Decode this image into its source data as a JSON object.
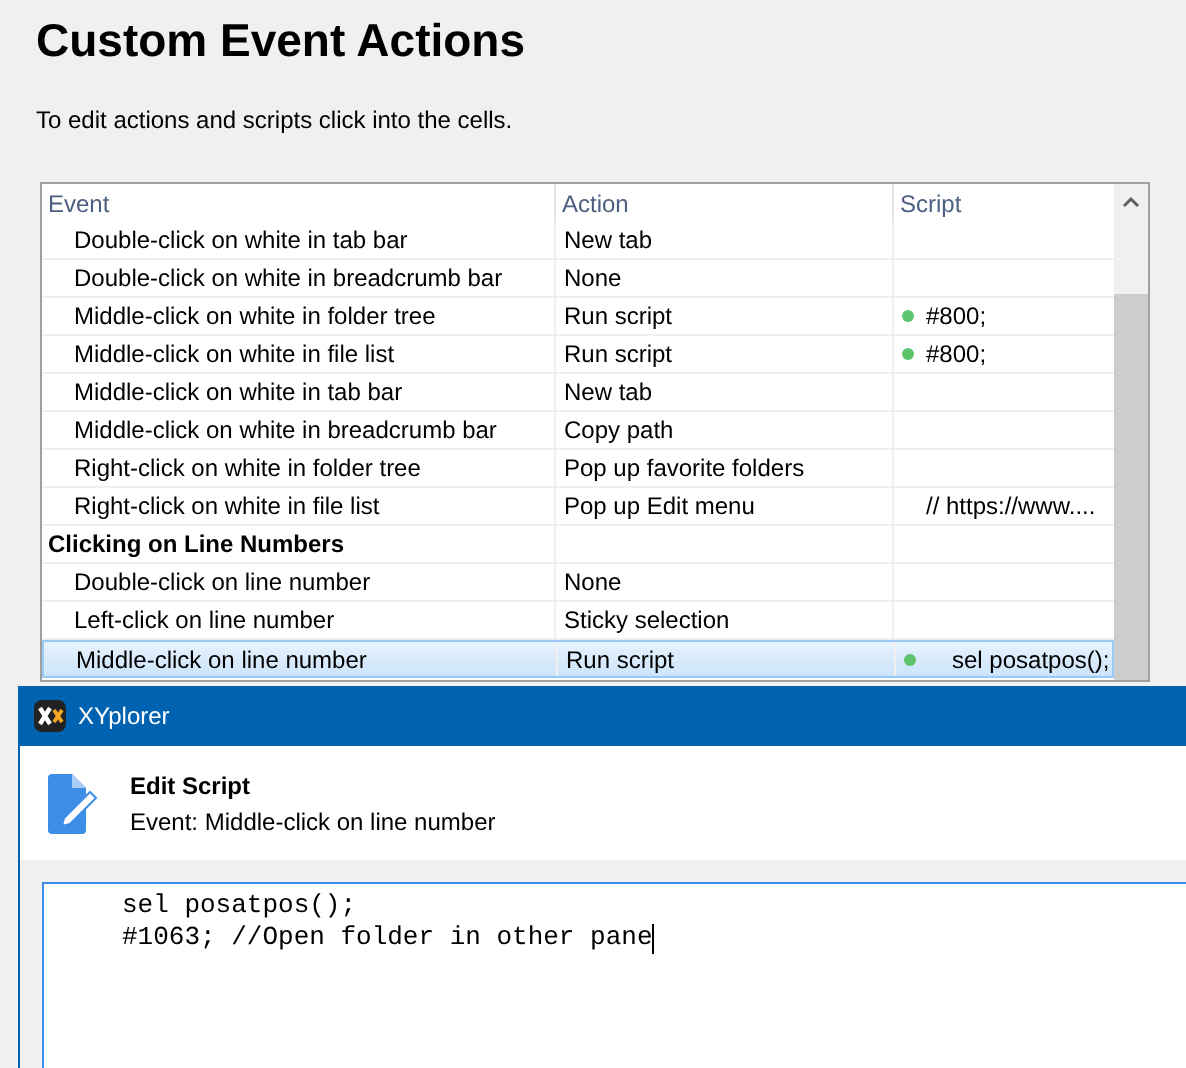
{
  "title": "Custom Event Actions",
  "instructions": "To edit actions and scripts click into the cells.",
  "table": {
    "columns": [
      "Event",
      "Action",
      "Script"
    ],
    "rows": [
      {
        "kind": "item",
        "event": "Double-click on white in tab bar",
        "action": "New tab",
        "dot": false,
        "selected": false
      },
      {
        "kind": "item",
        "event": "Double-click on white in breadcrumb bar",
        "action": "None",
        "dot": false,
        "selected": false
      },
      {
        "kind": "item",
        "event": "Middle-click on white in folder tree",
        "action": "Run script",
        "script": "#800;",
        "dot": true,
        "selected": false
      },
      {
        "kind": "item",
        "event": "Middle-click on white in file list",
        "action": "Run script",
        "script": "#800;",
        "dot": true,
        "selected": false
      },
      {
        "kind": "item",
        "event": "Middle-click on white in tab bar",
        "action": "New tab",
        "dot": false,
        "selected": false
      },
      {
        "kind": "item",
        "event": "Middle-click on white in breadcrumb bar",
        "action": "Copy path",
        "dot": false,
        "selected": false
      },
      {
        "kind": "item",
        "event": "Right-click on white in folder tree",
        "action": "Pop up favorite folders",
        "dot": false,
        "selected": false
      },
      {
        "kind": "item",
        "event": "Right-click on white in file list",
        "action": "Pop up Edit menu",
        "script": "// https://www....",
        "dot": false,
        "selected": false
      },
      {
        "kind": "group",
        "event": "Clicking on Line Numbers"
      },
      {
        "kind": "item",
        "event": "Double-click on line number",
        "action": "None",
        "dot": false,
        "selected": false
      },
      {
        "kind": "item",
        "event": "Left-click on line number",
        "action": "Sticky selection",
        "dot": false,
        "selected": false
      },
      {
        "kind": "item",
        "event": "Middle-click on line number",
        "action": "Run script",
        "script": "sel posatpos();",
        "dot": true,
        "selected": true
      }
    ]
  },
  "dialog": {
    "app_title": "XYplorer",
    "heading": "Edit Script",
    "subheading": "Event: Middle-click on line number",
    "script_lines": [
      "sel posatpos();",
      "#1063; //Open folder in other pane"
    ]
  }
}
